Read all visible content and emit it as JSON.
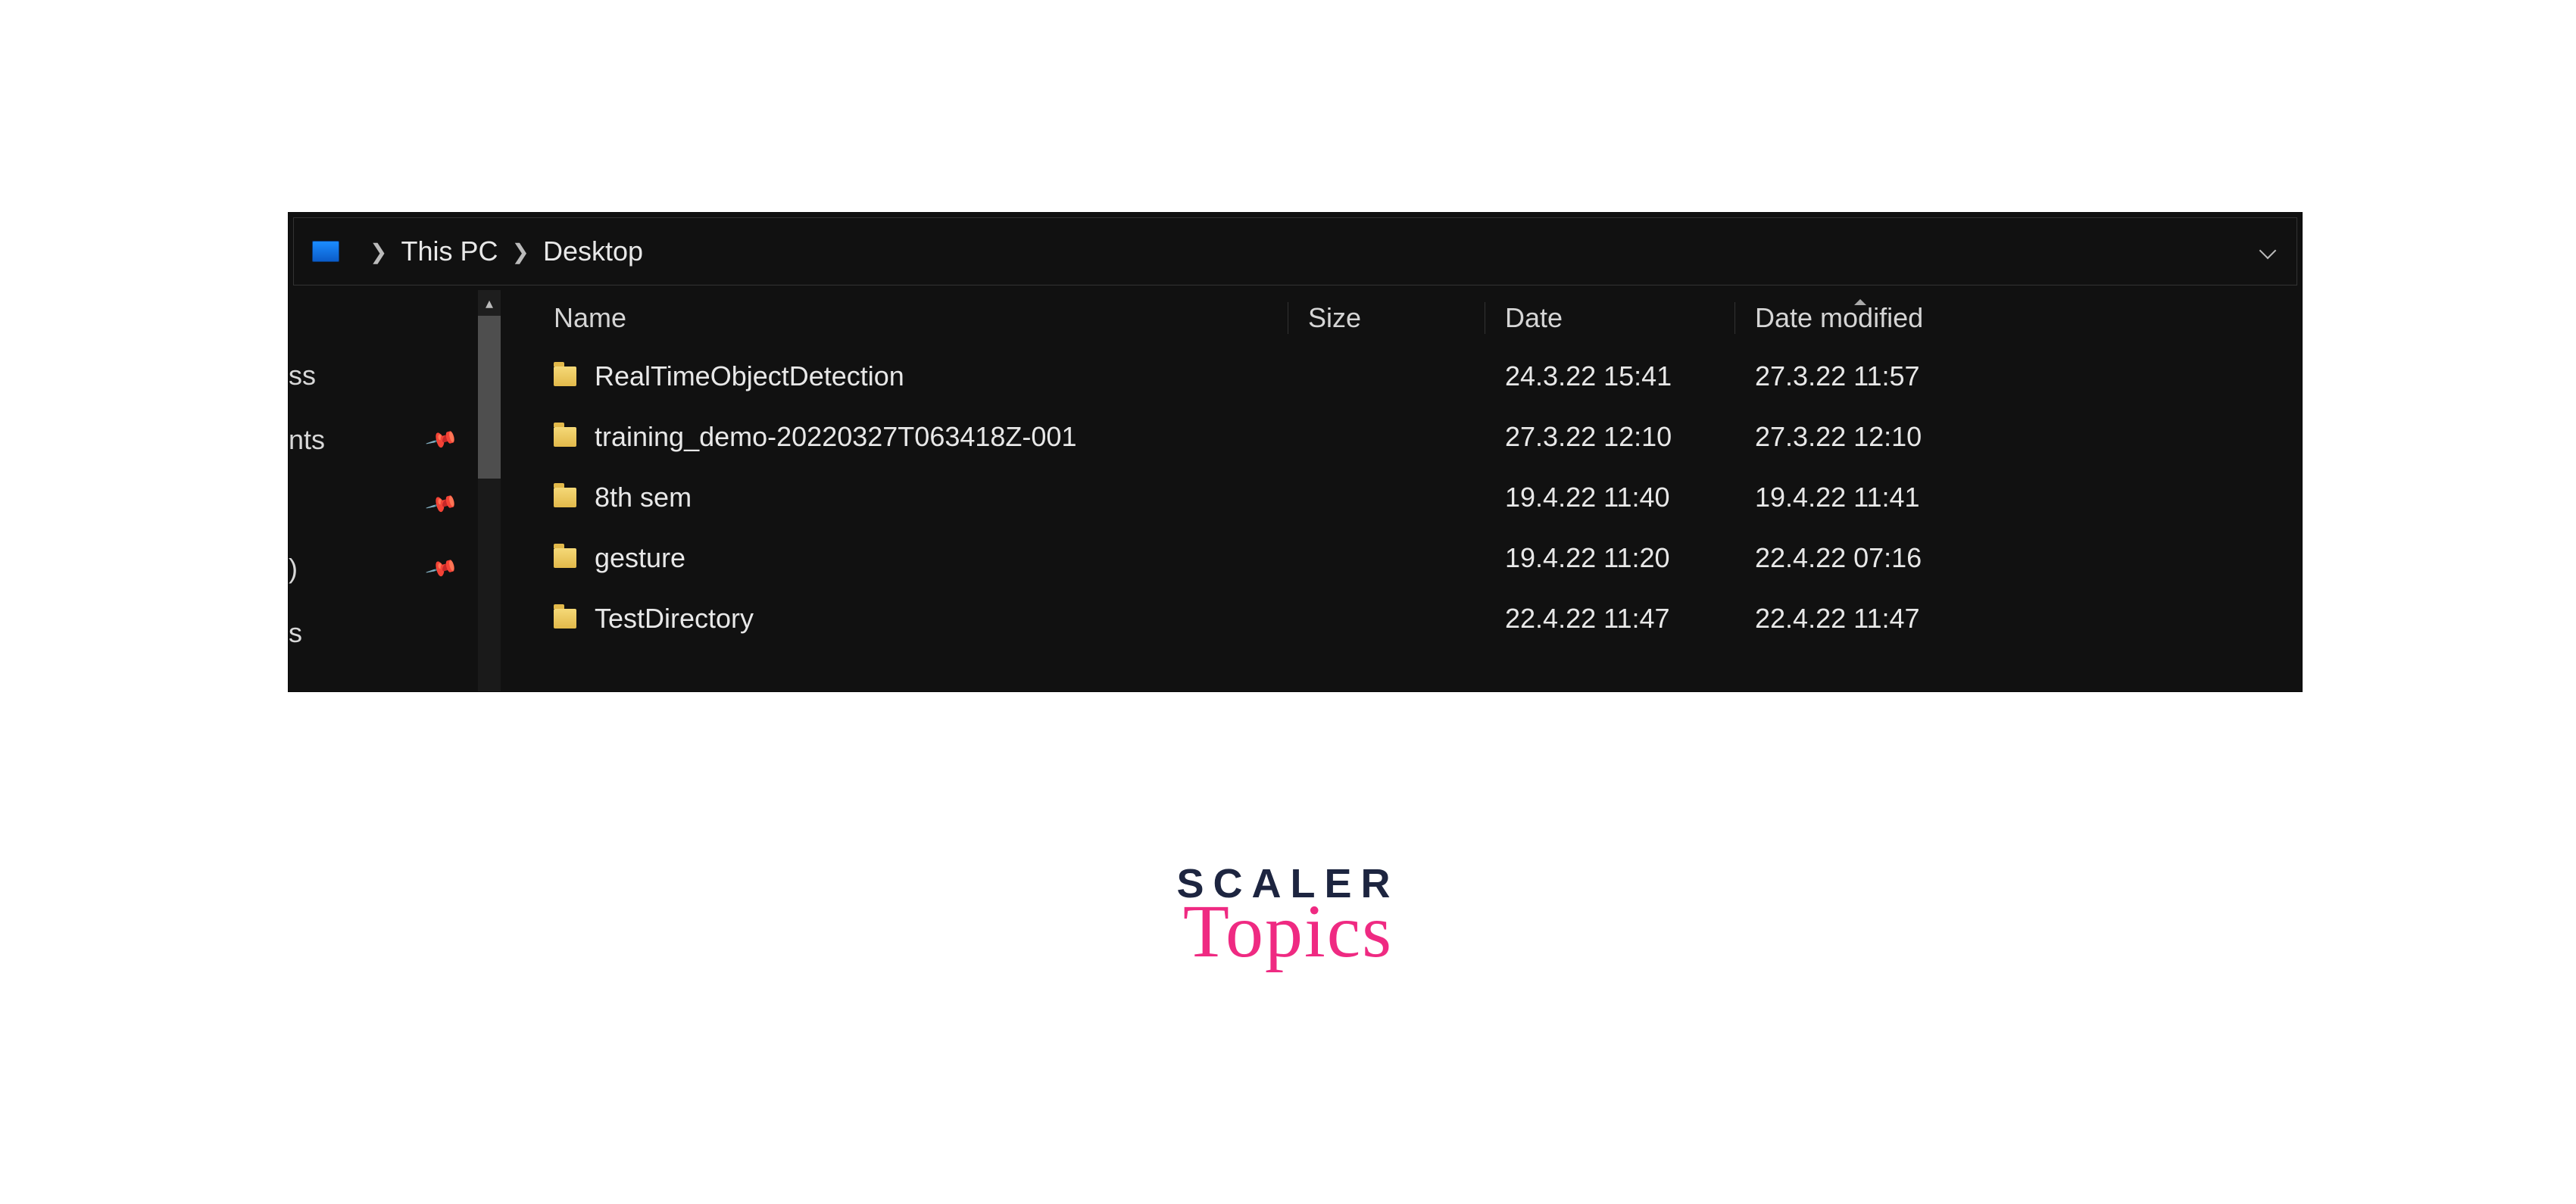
{
  "breadcrumb": {
    "segments": [
      "This PC",
      "Desktop"
    ]
  },
  "nav": {
    "items": [
      {
        "label": "ss",
        "pinned": false
      },
      {
        "label": "nts",
        "pinned": true
      },
      {
        "label": "",
        "pinned": true
      },
      {
        "label": ")",
        "pinned": true
      },
      {
        "label": "s",
        "pinned": false
      }
    ]
  },
  "columns": {
    "name": "Name",
    "size": "Size",
    "date": "Date",
    "modified": "Date modified",
    "sorted": "modified",
    "sort_dir": "asc"
  },
  "rows": [
    {
      "name": "RealTimeObjectDetection",
      "size": "",
      "date": "24.3.22 15:41",
      "modified": "27.3.22 11:57"
    },
    {
      "name": "training_demo-20220327T063418Z-001",
      "size": "",
      "date": "27.3.22 12:10",
      "modified": "27.3.22 12:10"
    },
    {
      "name": "8th sem",
      "size": "",
      "date": "19.4.22 11:40",
      "modified": "19.4.22 11:41"
    },
    {
      "name": "gesture",
      "size": "",
      "date": "19.4.22 11:20",
      "modified": "22.4.22 07:16"
    },
    {
      "name": "TestDirectory",
      "size": "",
      "date": "22.4.22 11:47",
      "modified": "22.4.22 11:47"
    }
  ],
  "brand": {
    "line1": "SCALER",
    "line2": "Topics"
  }
}
